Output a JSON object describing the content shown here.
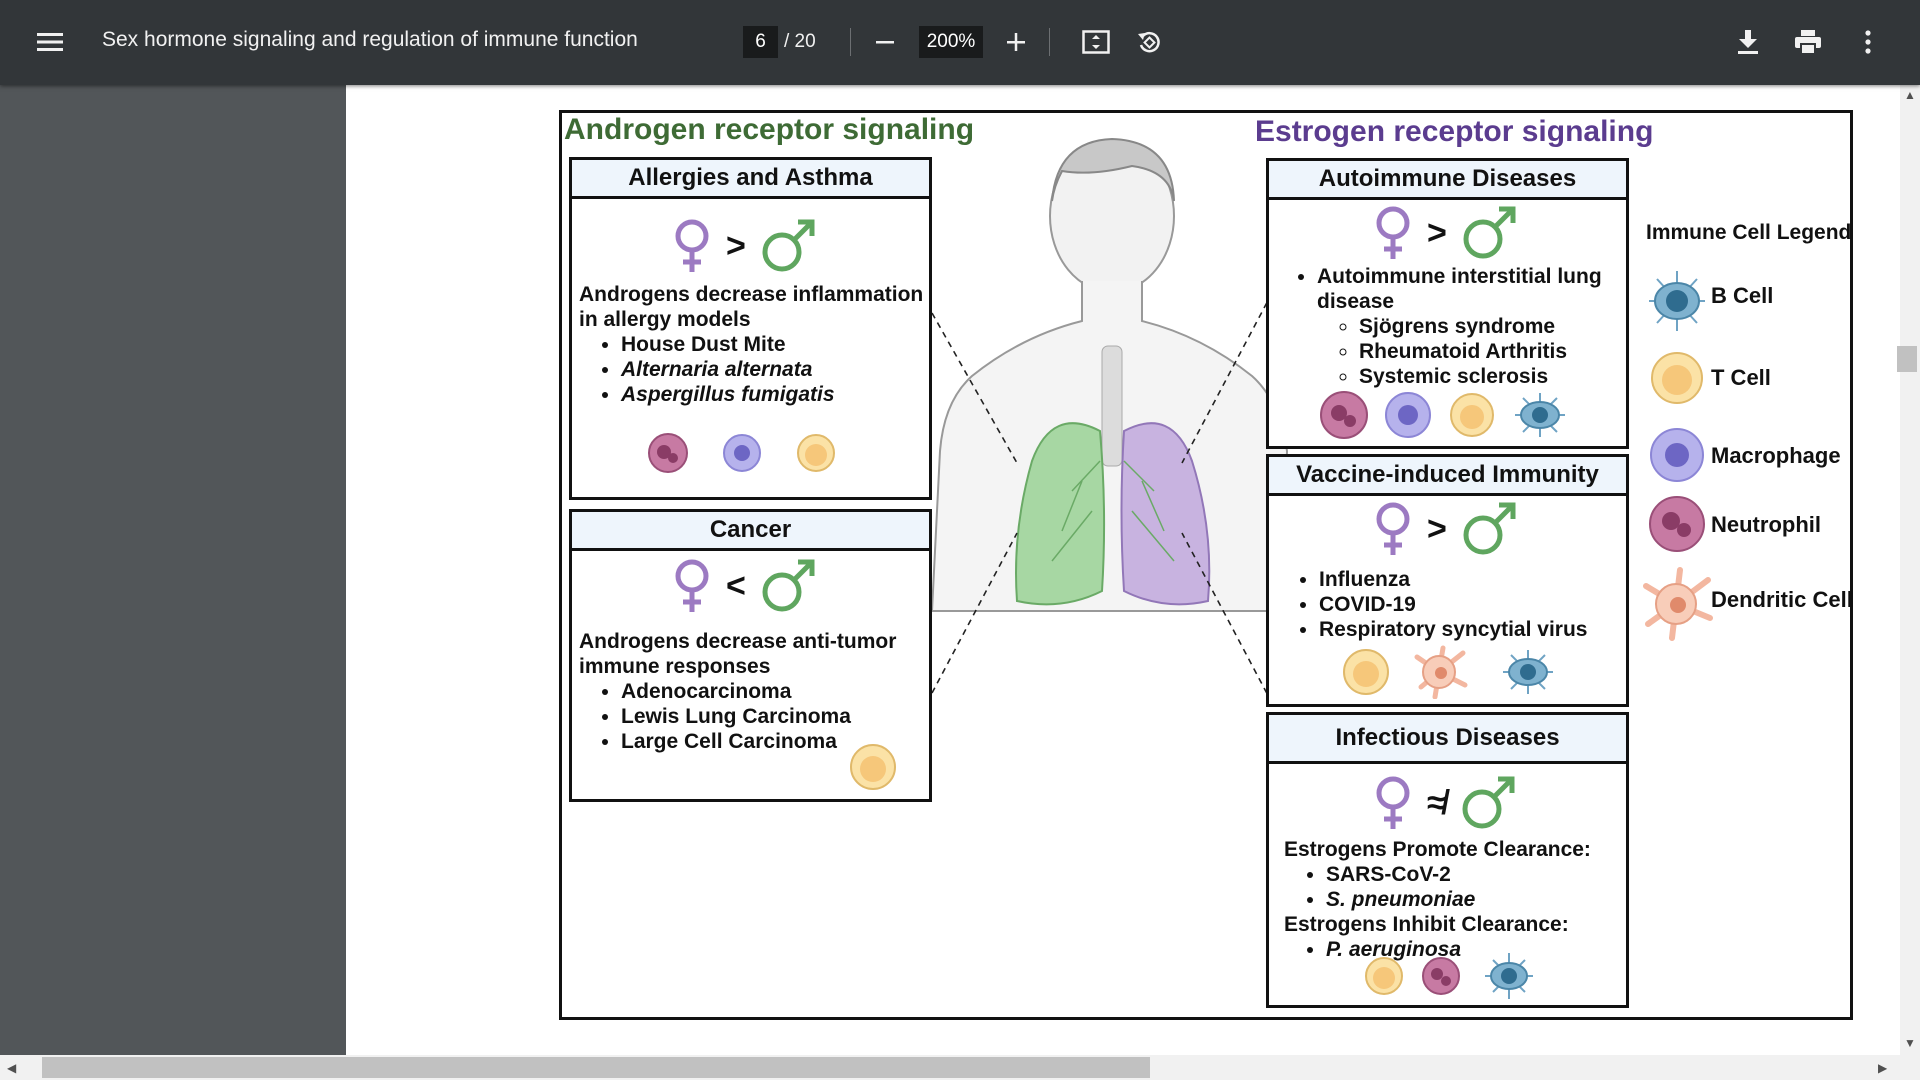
{
  "toolbar": {
    "menu_icon": "hamburger-menu-icon",
    "title": "Sex hormone signaling and regulation of immune function",
    "page_current": "6",
    "page_total": "/ 20",
    "zoom": "200%",
    "zoom_out_icon": "minus-icon",
    "zoom_in_icon": "plus-icon",
    "fit_icon": "fit-to-page-icon",
    "rotate_icon": "rotate-counterclockwise-icon",
    "download_icon": "download-icon",
    "print_icon": "print-icon",
    "more_icon": "more-vertical-icon"
  },
  "figure": {
    "androgen_title": "Androgen receptor signaling",
    "estrogen_title": "Estrogen receptor signaling",
    "colors": {
      "androgen": "#3e6b35",
      "estrogen": "#5b3c8f",
      "female": "#9c7ac2",
      "male": "#5fa65f"
    },
    "panels": {
      "allergies": {
        "title": "Allergies and Asthma",
        "relation": ">",
        "intro": "Androgens decrease inflammation in allergy models",
        "bullets": [
          "House Dust Mite",
          "Alternaria alternata",
          "Aspergillus fumigatis"
        ]
      },
      "cancer": {
        "title": "Cancer",
        "relation": "<",
        "intro": "Androgens decrease anti-tumor immune responses",
        "bullets": [
          "Adenocarcinoma",
          "Lewis Lung Carcinoma",
          "Large Cell Carcinoma"
        ]
      },
      "autoimmune": {
        "title": "Autoimmune Diseases",
        "relation": ">",
        "bullet": "Autoimmune interstitial lung disease",
        "sub_bullets": [
          "Sjögrens syndrome",
          "Rheumatoid Arthritis",
          "Systemic sclerosis"
        ]
      },
      "vaccine": {
        "title": "Vaccine-induced Immunity",
        "relation": ">",
        "bullets": [
          "Influenza",
          "COVID-19",
          "Respiratory syncytial virus"
        ]
      },
      "infectious": {
        "title": "Infectious Diseases",
        "relation": "≉",
        "promote_label": "Estrogens Promote Clearance:",
        "promote": [
          "SARS-CoV-2",
          "S. pneumoniae"
        ],
        "inhibit_label": "Estrogens Inhibit Clearance:",
        "inhibit": [
          "P. aeruginosa"
        ]
      }
    },
    "legend": {
      "title": "Immune Cell Legend",
      "items": [
        "B Cell",
        "T Cell",
        "Macrophage",
        "Neutrophil",
        "Dendritic Cell"
      ]
    }
  }
}
